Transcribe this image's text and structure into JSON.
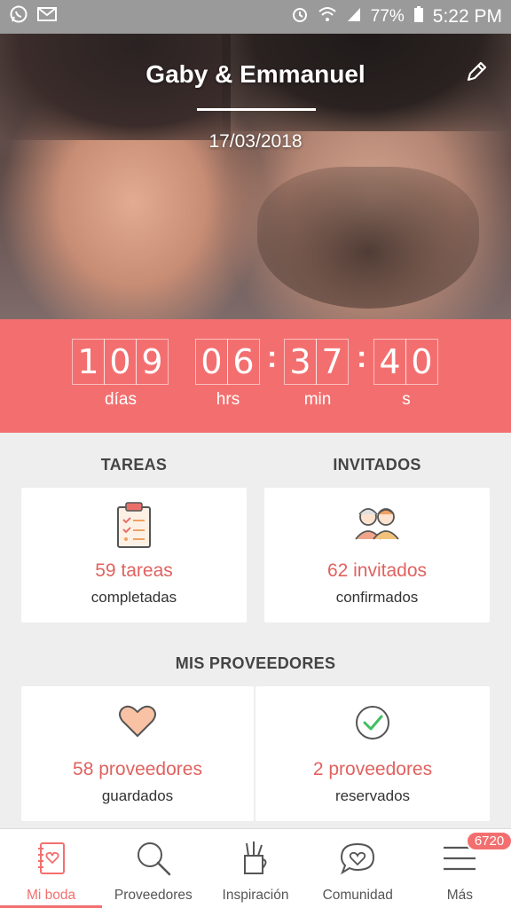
{
  "status_bar": {
    "battery": "77%",
    "time": "5:22 PM"
  },
  "hero": {
    "couple_names": "Gaby & Emmanuel",
    "date": "17/03/2018"
  },
  "countdown": {
    "days": [
      "1",
      "0",
      "9"
    ],
    "hours": [
      "0",
      "6"
    ],
    "minutes": [
      "3",
      "7"
    ],
    "seconds": [
      "4",
      "0"
    ],
    "label_days": "días",
    "label_hours": "hrs",
    "label_minutes": "min",
    "label_seconds": "s"
  },
  "tareas": {
    "title": "TAREAS",
    "value": "59 tareas",
    "sub": "completadas"
  },
  "invitados": {
    "title": "INVITADOS",
    "value": "62 invitados",
    "sub": "confirmados"
  },
  "proveedores": {
    "title": "MIS PROVEEDORES",
    "guardados_value": "58 proveedores",
    "guardados_sub": "guardados",
    "reservados_value": "2 proveedores",
    "reservados_sub": "reservados"
  },
  "nav": {
    "items": [
      {
        "label": "Mi boda",
        "icon": "notebook-icon"
      },
      {
        "label": "Proveedores",
        "icon": "search-icon"
      },
      {
        "label": "Inspiración",
        "icon": "pencil-cup-icon"
      },
      {
        "label": "Comunidad",
        "icon": "chat-heart-icon"
      },
      {
        "label": "Más",
        "icon": "menu-icon"
      }
    ],
    "badge": "6720"
  },
  "colors": {
    "accent": "#f36f6f",
    "value_text": "#e0625f"
  }
}
